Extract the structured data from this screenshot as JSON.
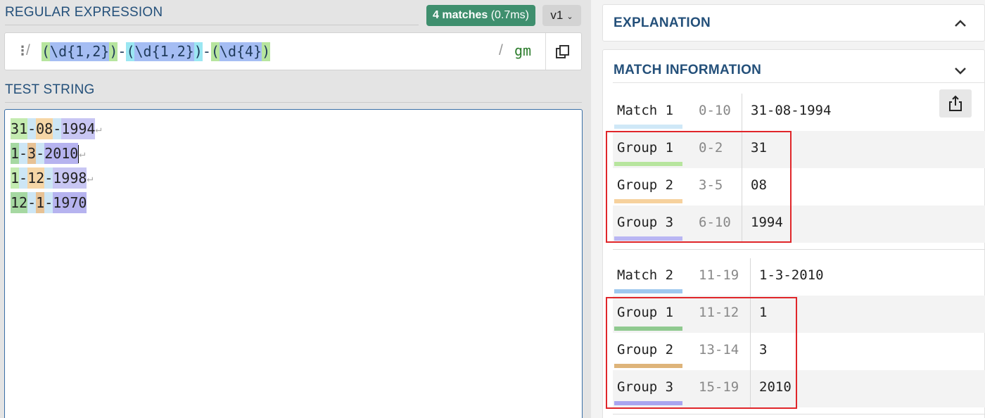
{
  "regex_panel": {
    "title": "REGULAR EXPRESSION",
    "matches_badge": {
      "count": "4 matches",
      "time": "(0.7ms)"
    },
    "version": "v1",
    "delimiter_open": "/",
    "delimiter_close": "/",
    "pattern_tokens": [
      "(",
      "\\d{1,2}",
      ")",
      "-",
      "(",
      "\\d{1,2}",
      ")",
      "-",
      "(",
      "\\d{4}",
      ")"
    ],
    "flags": "gm",
    "icons": {
      "menu": "vertical-dots-icon",
      "copy": "copy-icon"
    }
  },
  "test_panel": {
    "title": "TEST STRING",
    "lines": [
      [
        "31",
        "-",
        "08",
        "-",
        "1994"
      ],
      [
        "1",
        "-",
        "3",
        "-",
        "2010"
      ],
      [
        "1",
        "-",
        "12",
        "-",
        "1998"
      ],
      [
        "12",
        "-",
        "1",
        "-",
        "1970"
      ]
    ],
    "newline_glyph": "↵"
  },
  "explanation": {
    "title": "EXPLANATION"
  },
  "match_info": {
    "title": "MATCH INFORMATION",
    "share_icon": "share-icon",
    "matches": [
      {
        "label": "Match 1",
        "range": "0-10",
        "value": "31-08-1994",
        "groups": [
          {
            "label": "Group 1",
            "range": "0-2",
            "value": "31"
          },
          {
            "label": "Group 2",
            "range": "3-5",
            "value": "08"
          },
          {
            "label": "Group 3",
            "range": "6-10",
            "value": "1994"
          }
        ]
      },
      {
        "label": "Match 2",
        "range": "11-19",
        "value": "1-3-2010",
        "groups": [
          {
            "label": "Group 1",
            "range": "11-12",
            "value": "1"
          },
          {
            "label": "Group 2",
            "range": "13-14",
            "value": "3"
          },
          {
            "label": "Group 3",
            "range": "15-19",
            "value": "2010"
          }
        ]
      }
    ]
  },
  "colors": {
    "accent": "#24507a",
    "badge": "#3f8f6e",
    "highlight_box": "#e0262a",
    "group1": "#b7e59e",
    "group2": "#f6d19d",
    "group3": "#b9b6f3",
    "match": "#cfe8f7"
  }
}
